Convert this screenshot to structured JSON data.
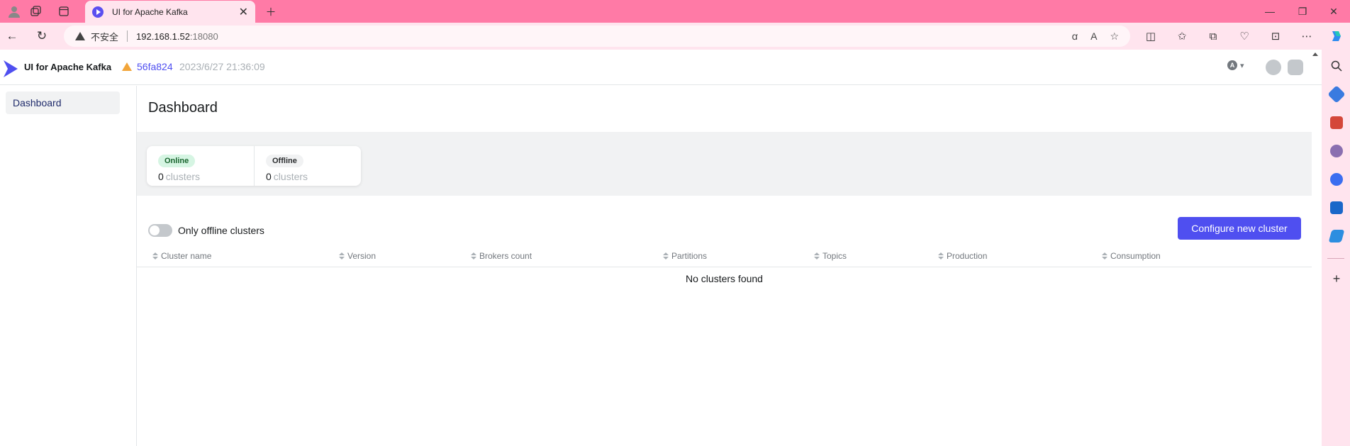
{
  "browser": {
    "tab_title": "UI for Apache Kafka",
    "insecure_label": "不安全",
    "url_host": "192.168.1.52",
    "url_port": ":18080"
  },
  "header": {
    "brand": "UI for Apache Kafka",
    "version_hash": "56fa824",
    "version_date": "2023/6/27 21:36:09",
    "user_initial": "A"
  },
  "sidebar": {
    "items": [
      {
        "label": "Dashboard"
      }
    ]
  },
  "main": {
    "title": "Dashboard",
    "stats": [
      {
        "badge": "Online",
        "value": "0",
        "unit": "clusters"
      },
      {
        "badge": "Offline",
        "value": "0",
        "unit": "clusters"
      }
    ],
    "toggle_label": "Only offline clusters",
    "configure_button": "Configure new cluster",
    "columns": [
      "Cluster name",
      "Version",
      "Brokers count",
      "Partitions",
      "Topics",
      "Production",
      "Consumption"
    ],
    "empty_message": "No clusters found"
  },
  "colors": {
    "accent": "#4f4ff0",
    "chrome": "#ff7aa6",
    "online_badge": "#d6f5e3"
  }
}
